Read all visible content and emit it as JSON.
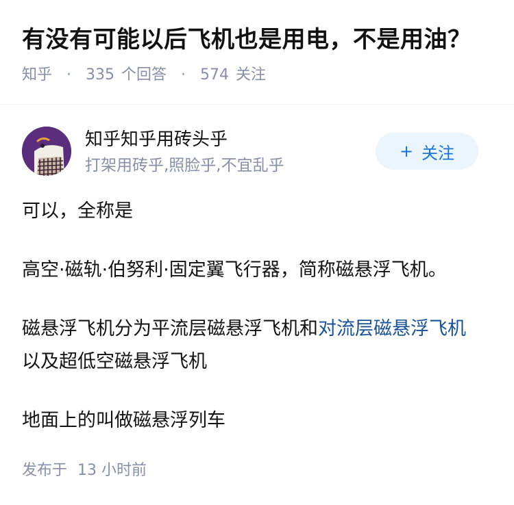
{
  "question": {
    "title": "有没有可能以后飞机也是用电，不是用油？",
    "source": "知乎",
    "answers_count": "335",
    "answers_label": "个回答",
    "followers_count": "574",
    "followers_label": "关注"
  },
  "author": {
    "name": "知乎知乎用砖头乎",
    "bio": "打架用砖乎,照脸乎,不宜乱乎",
    "follow_plus": "+",
    "follow_label": "关注"
  },
  "answer": {
    "paragraph_1": "可以，全称是",
    "paragraph_2": "高空·磁轨·伯努利·固定翼飞行器，简称磁悬浮飞机。",
    "paragraph_3_before": "磁悬浮飞机分为平流层磁悬浮飞机和",
    "paragraph_3_link": "对流层磁悬浮飞机",
    "paragraph_3_after": "以及超低空磁悬浮飞机",
    "paragraph_4": "地面上的叫做磁悬浮列车"
  },
  "footer": {
    "published_label": "发布于",
    "published_value": "13 小时前"
  },
  "colors": {
    "accent": "#1772d9",
    "link": "#175199",
    "meta": "#8590a6",
    "follow_bg": "#ebf5fd"
  }
}
